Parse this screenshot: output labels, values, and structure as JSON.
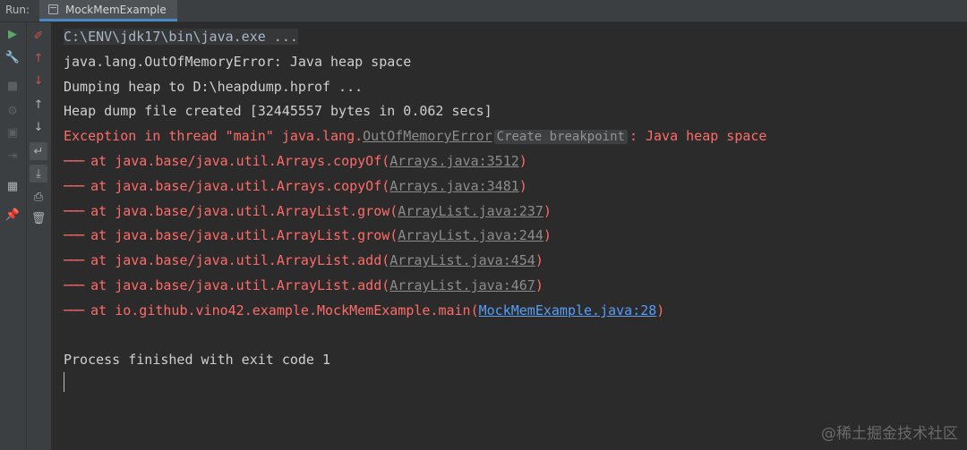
{
  "run_tab": {
    "run_label": "Run:",
    "tab_label": "MockMemExample",
    "tab_icon": "run-config-icon"
  },
  "toolbar_left": [
    {
      "icon": "rerun-icon",
      "glyph": "▶",
      "color": "#59a869"
    },
    {
      "icon": "wrench-icon",
      "glyph": "🔧",
      "color": "#afb1b3"
    },
    {
      "icon": "stop-icon",
      "glyph": "■",
      "color": "#5c5f61"
    },
    {
      "icon": "debug-icon",
      "glyph": "⚙",
      "color": "#5c5f61"
    },
    {
      "icon": "camera-icon",
      "glyph": "▣",
      "color": "#5c5f61"
    },
    {
      "icon": "exit-icon",
      "glyph": "⇥",
      "color": "#5c5f61"
    },
    {
      "icon": "layout-icon",
      "glyph": "▦",
      "color": "#afb1b3"
    },
    {
      "icon": "pin-icon",
      "glyph": "📌",
      "color": "#afb1b3"
    }
  ],
  "toolbar_right": [
    {
      "icon": "clear-output-icon",
      "glyph": "✐",
      "color": "#c75450"
    },
    {
      "icon": "previous-error-icon",
      "glyph": "↑",
      "color": "#c75450"
    },
    {
      "icon": "next-error-icon",
      "glyph": "↓",
      "color": "#c75450"
    },
    {
      "icon": "up-arrow-icon",
      "glyph": "↑",
      "color": "#afb1b3"
    },
    {
      "icon": "down-arrow-icon",
      "glyph": "↓",
      "color": "#afb1b3"
    },
    {
      "icon": "soft-wrap-icon",
      "glyph": "↵",
      "color": "#afb1b3"
    },
    {
      "icon": "scroll-to-end-icon",
      "glyph": "⤓",
      "color": "#afb1b3"
    },
    {
      "icon": "print-icon",
      "glyph": "⎙",
      "color": "#afb1b3"
    },
    {
      "icon": "trash-icon",
      "glyph": "🗑",
      "color": "#afb1b3"
    }
  ],
  "console": {
    "command": "C:\\ENV\\jdk17\\bin\\java.exe ...",
    "oom": "java.lang.OutOfMemoryError: Java heap space",
    "dumping": "Dumping heap to D:\\heapdump.hprof ...",
    "dump_created": "Heap dump file created [32445557 bytes in 0.062 secs]",
    "exception_prefix": "Exception in thread \"main\" java.lang.",
    "exception_class": "OutOfMemoryError",
    "create_breakpoint": "Create breakpoint",
    "exception_suffix": ": Java heap space",
    "stack_dash": "───",
    "stack": [
      {
        "method": " at java.base/java.util.Arrays.copyOf(",
        "location": "Arrays.java:3512",
        "close": ")"
      },
      {
        "method": " at java.base/java.util.Arrays.copyOf(",
        "location": "Arrays.java:3481",
        "close": ")"
      },
      {
        "method": " at java.base/java.util.ArrayList.grow(",
        "location": "ArrayList.java:237",
        "close": ")"
      },
      {
        "method": " at java.base/java.util.ArrayList.grow(",
        "location": "ArrayList.java:244",
        "close": ")"
      },
      {
        "method": " at java.base/java.util.ArrayList.add(",
        "location": "ArrayList.java:454",
        "close": ")"
      },
      {
        "method": " at java.base/java.util.ArrayList.add(",
        "location": "ArrayList.java:467",
        "close": ")"
      },
      {
        "method": " at io.github.vino42.example.MockMemExample.main(",
        "location": "MockMemExample.java:28",
        "close": ")"
      }
    ],
    "process_finished": "Process finished with exit code 1"
  },
  "watermark": "@稀土掘金技术社区"
}
